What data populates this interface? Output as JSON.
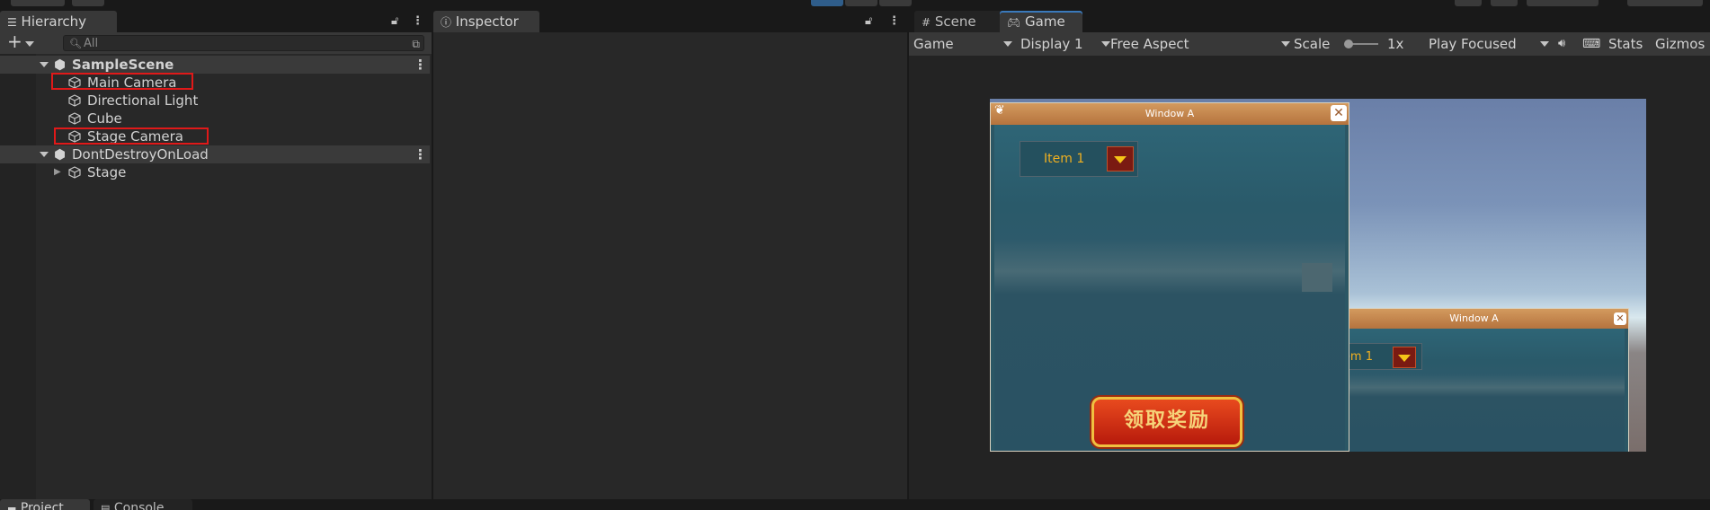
{
  "hierarchy": {
    "tab_label": "Hierarchy",
    "search_placeholder": "All",
    "add_label": "+",
    "scenes": [
      {
        "name": "SampleScene",
        "items": [
          "Main Camera",
          "Directional Light",
          "Cube",
          "Stage Camera"
        ]
      },
      {
        "name": "DontDestroyOnLoad",
        "items": [
          "Stage"
        ]
      }
    ]
  },
  "inspector": {
    "tab_label": "Inspector"
  },
  "game_panel": {
    "tabs": [
      "Scene",
      "Game"
    ],
    "toolbar": {
      "view": "Game",
      "display": "Display 1",
      "aspect": "Free Aspect",
      "scale_label": "Scale",
      "scale_value": "1x",
      "play_mode": "Play Focused",
      "stats": "Stats",
      "gizmos": "Gizmos"
    },
    "window_a": {
      "title": "Window A",
      "dropdown_value": "Item 1",
      "button_label": "领取奖励"
    },
    "window_a2": {
      "title": "Window A",
      "dropdown_value": "Item 1"
    }
  },
  "bottom": {
    "tabs": [
      "Project",
      "Console"
    ]
  },
  "colors": {
    "highlight_box": "#e01919",
    "accent": "#3a79bb"
  }
}
